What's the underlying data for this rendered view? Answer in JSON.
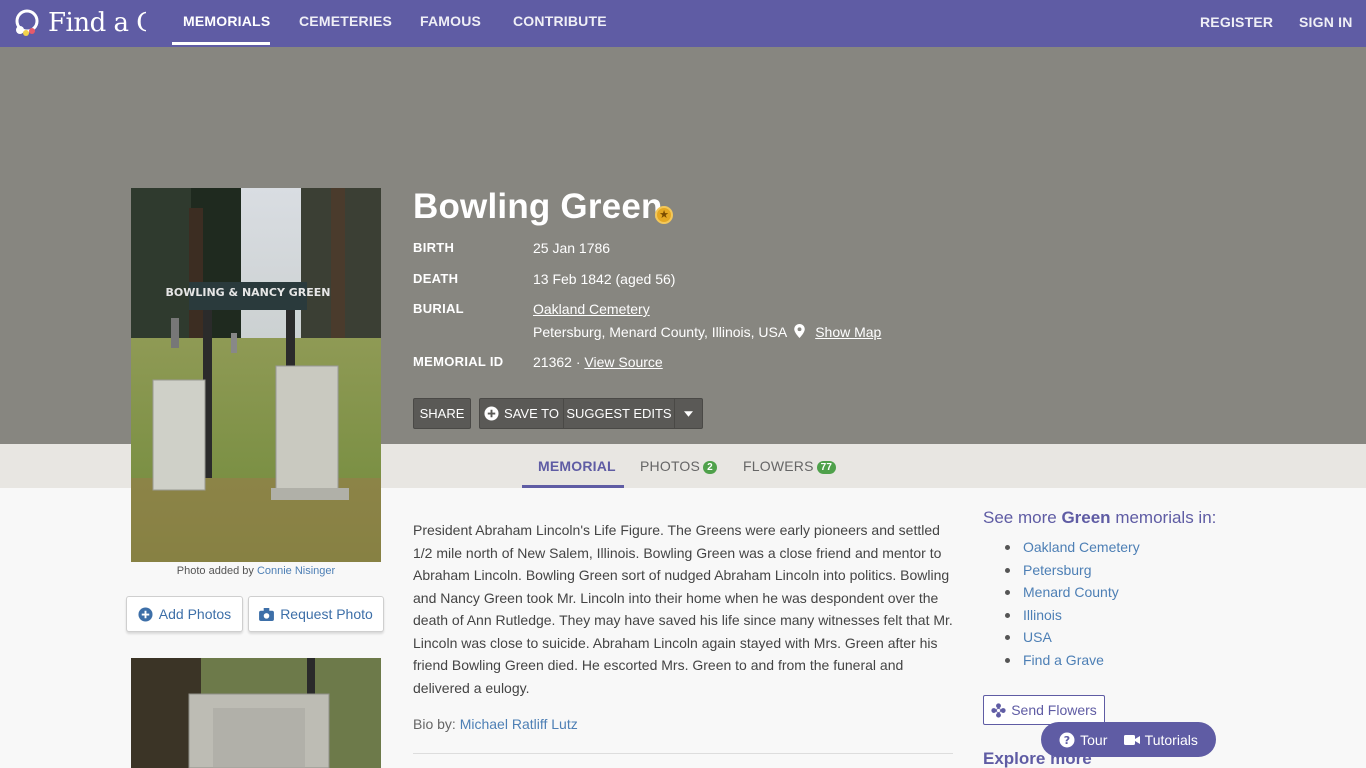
{
  "nav": {
    "brand": "Find a Grave",
    "items": [
      {
        "label": "MEMORIALS",
        "active": true
      },
      {
        "label": "CEMETERIES"
      },
      {
        "label": "FAMOUS"
      },
      {
        "label": "CONTRIBUTE"
      }
    ],
    "register": "REGISTER",
    "signin": "SIGN IN"
  },
  "memorial": {
    "name": "Bowling Green",
    "fields": {
      "birth_label": "BIRTH",
      "birth": "25 Jan 1786",
      "death_label": "DEATH",
      "death": "13 Feb 1842 (aged 56)",
      "burial_label": "BURIAL",
      "cemetery": "Oakland Cemetery",
      "location": "Petersburg, Menard County, Illinois, USA",
      "show_map": "Show Map",
      "id_label": "MEMORIAL ID",
      "id": "21362 ·",
      "view_source": "View Source"
    },
    "actions": {
      "share": "SHARE",
      "save_to": "SAVE TO",
      "suggest": "SUGGEST EDITS"
    }
  },
  "photo": {
    "sign_text": "BOWLING & NANCY GREEN",
    "caption_prefix": "Photo added by",
    "caption_author": "Connie Nisinger",
    "add": "Add Photos",
    "request": "Request Photo"
  },
  "tabs": {
    "memorial": "MEMORIAL",
    "photos": "PHOTOS",
    "photos_count": "2",
    "flowers": "FLOWERS",
    "flowers_count": "77"
  },
  "bio": {
    "text": "President Abraham Lincoln's Life Figure. The Greens were early pioneers and settled 1/2 mile north of New Salem, Illinois. Bowling Green was a close friend and mentor to Abraham Lincoln. Bowling Green sort of nudged Abraham Lincoln into politics. Bowling and Nancy Green took Mr. Lincoln into their home when he was despondent over the death of Ann Rutledge. They may have saved his life since many witnesses felt that Mr. Lincoln was close to suicide. Abraham Lincoln again stayed with Mrs. Green after his friend Bowling Green died. He escorted Mrs. Green to and from the funeral and delivered a eulogy.",
    "by_label": "Bio by:",
    "by_author": "Michael Ratliff Lutz"
  },
  "sidebar": {
    "see_more_prefix": "See more",
    "surname": "Green",
    "see_more_suffix": "memorials in:",
    "locations": [
      "Oakland Cemetery",
      "Petersburg",
      "Menard County",
      "Illinois",
      "USA",
      "Find a Grave"
    ],
    "send_flowers": "Send Flowers",
    "explore": "Explore more"
  },
  "help": {
    "tour": "Tour",
    "tutorials": "Tutorials"
  },
  "colors": {
    "nav": "#5f5ca4",
    "hero": "#878680",
    "link": "#4d7fb5",
    "badge": "#4fa14b"
  }
}
